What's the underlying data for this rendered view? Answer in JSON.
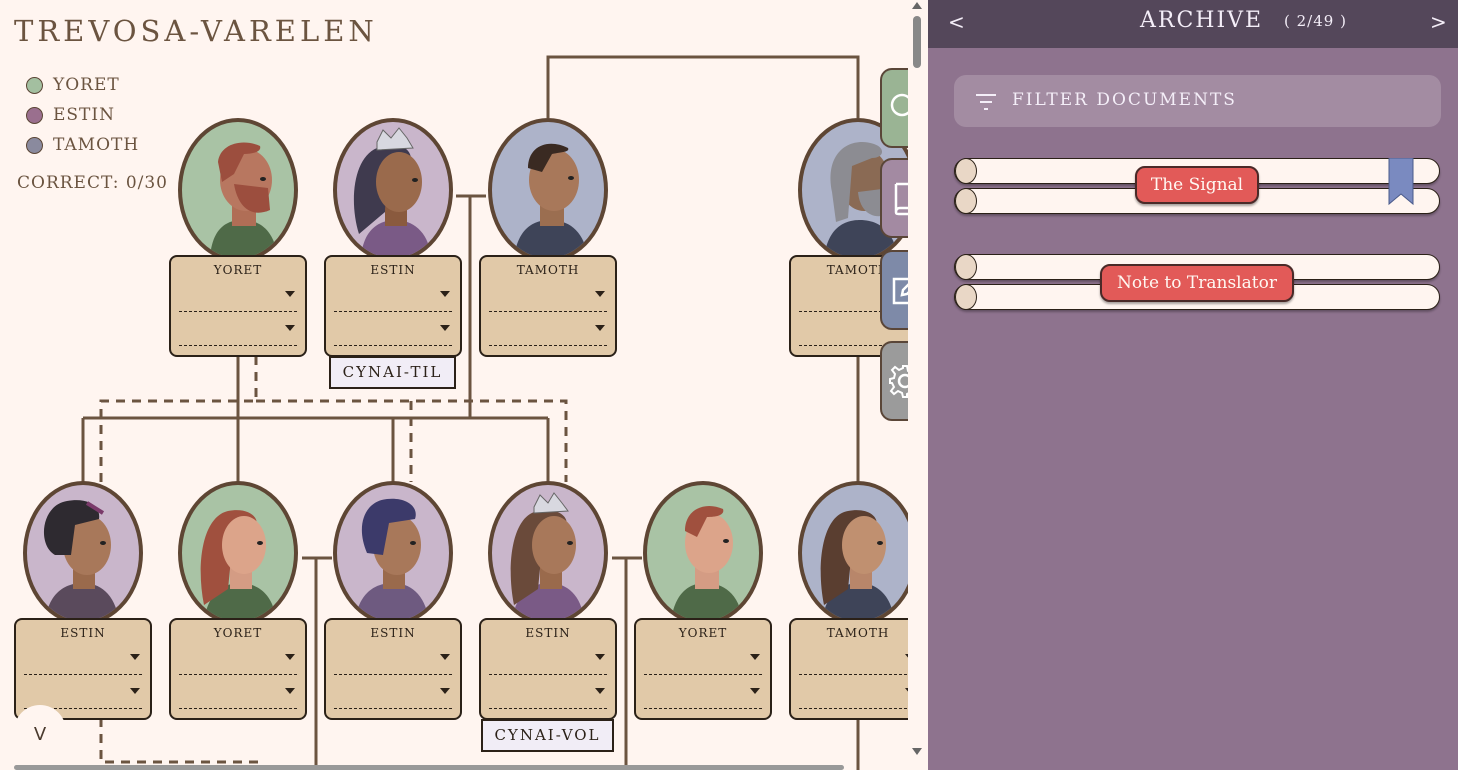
{
  "tree": {
    "title": "TREVOSA-VARELEN",
    "correct_label": "CORRECT: 0/30",
    "legend": [
      {
        "label": "YORET",
        "color": "#a3bfa0"
      },
      {
        "label": "ESTIN",
        "color": "#9a6f8e"
      },
      {
        "label": "TAMOTH",
        "color": "#8a8a9e"
      }
    ],
    "people_row1": [
      {
        "group": "YORET"
      },
      {
        "group": "ESTIN"
      },
      {
        "group": "TAMOTH"
      },
      {
        "group": "TAMOTH"
      }
    ],
    "people_row2": [
      {
        "group": "ESTIN"
      },
      {
        "group": "YORET"
      },
      {
        "group": "ESTIN"
      },
      {
        "group": "ESTIN"
      },
      {
        "group": "YORET"
      },
      {
        "group": "TAMOTH"
      }
    ],
    "tags": [
      "CYNAI-TIL",
      "CYNAI-VOL"
    ],
    "collapse": "V"
  },
  "tools": [
    {
      "icon": "search-icon",
      "color": "#9ab494"
    },
    {
      "icon": "book-icon",
      "color": "#a38aa2"
    },
    {
      "icon": "edit-icon",
      "color": "#7e8aa8"
    },
    {
      "icon": "gear-icon",
      "color": "#9b9b9b"
    }
  ],
  "archive": {
    "prev": "<",
    "next": ">",
    "title": "ARCHIVE",
    "count": "( 2/49 )",
    "filter_label": "FILTER DOCUMENTS",
    "documents": [
      {
        "label": "The Signal",
        "bookmarked": true
      },
      {
        "label": "Note to Translator",
        "bookmarked": false
      }
    ]
  }
}
